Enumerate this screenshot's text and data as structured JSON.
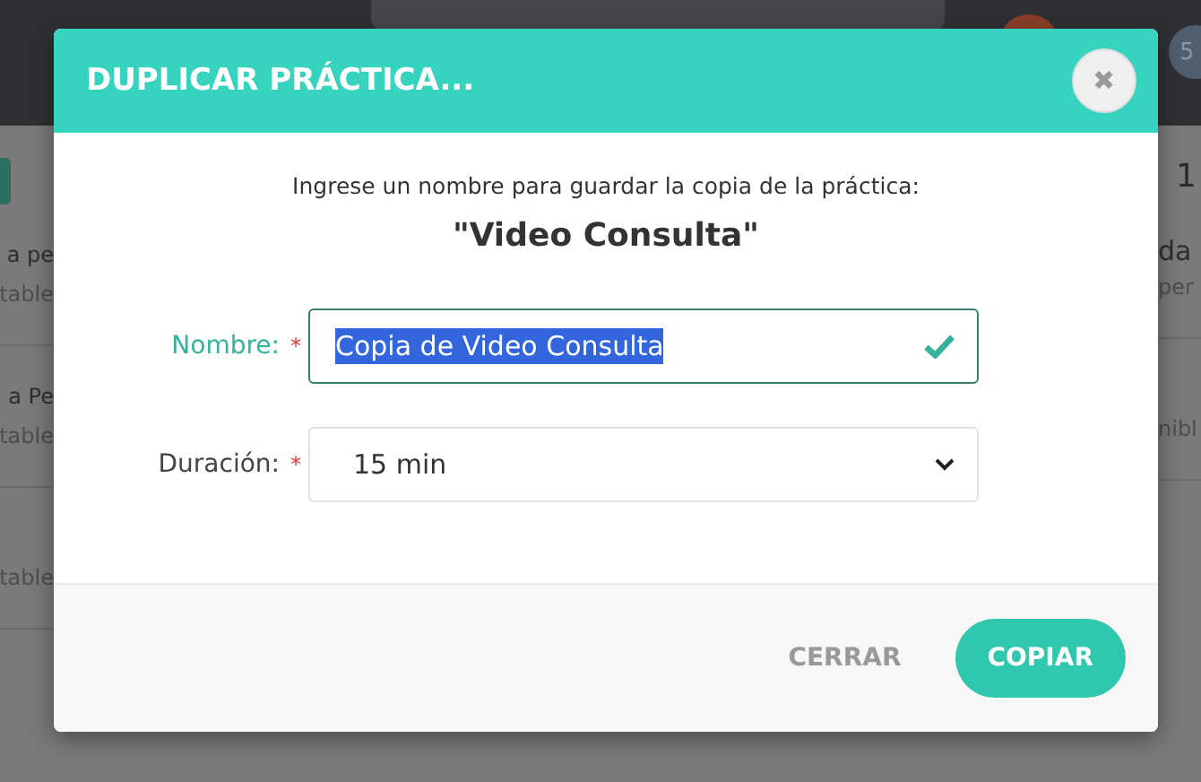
{
  "background": {
    "top_right_count": "1",
    "avatar_badge": "5",
    "left_rows": [
      {
        "title": "a pe",
        "subtitle": "table"
      },
      {
        "title": "a Pe",
        "subtitle": "table"
      },
      {
        "title": "",
        "subtitle": "table"
      }
    ],
    "right_rows": [
      {
        "title": "da",
        "subtitle": "per"
      },
      {
        "title": "",
        "subtitle": "nibl"
      }
    ]
  },
  "dialog": {
    "title": "DUPLICAR PRÁCTICA...",
    "close": "✖",
    "prompt": "Ingrese un nombre para guardar la copia de la práctica:",
    "practice_name": "\"Video Consulta\"",
    "fields": [
      {
        "kind": "text",
        "label": "Nombre:",
        "required_mark": "*",
        "valid": true,
        "value": "Copia de Video Consulta"
      },
      {
        "kind": "select",
        "label": "Duración:",
        "required_mark": "*",
        "valid": false,
        "value": "15 min"
      }
    ],
    "buttons": [
      {
        "label": "CERRAR",
        "kind": "secondary"
      },
      {
        "label": "COPIAR",
        "kind": "primary"
      }
    ]
  }
}
